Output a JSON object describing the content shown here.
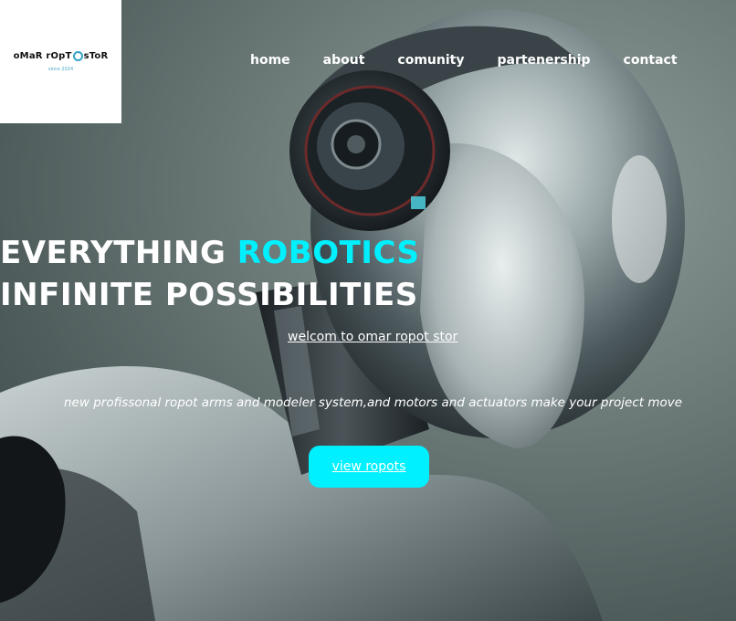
{
  "logo": {
    "brand_part1": "oMaR rOpT",
    "brand_part2": "sToR",
    "since": "since 2024"
  },
  "nav": {
    "items": [
      {
        "label": "home"
      },
      {
        "label": "about"
      },
      {
        "label": "comunity"
      },
      {
        "label": "partenership"
      },
      {
        "label": "contact"
      }
    ]
  },
  "hero": {
    "headline_part1": "EVERYTHING ",
    "headline_accent": "ROBOTICS",
    "headline_part2": " INFINITE POSSIBILITIES",
    "welcome": "welcom to omar ropot stor",
    "tagline": "new profissonal ropot arms and modeler system,and motors and actuators make your project move",
    "cta_label": "view ropots"
  },
  "colors": {
    "accent": "#00f0ff",
    "logo_accent": "#36a3c9"
  }
}
